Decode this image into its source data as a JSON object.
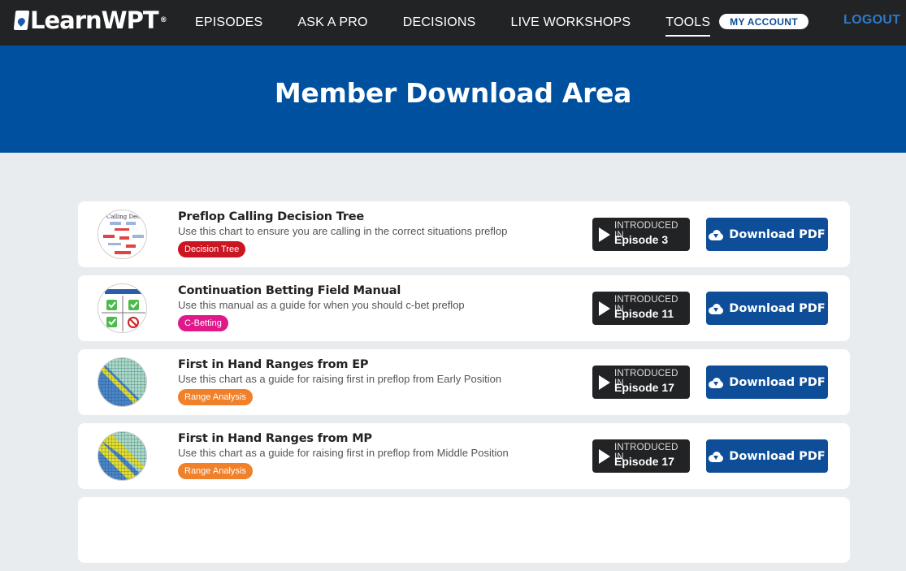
{
  "header": {
    "logo": "LearnWPT",
    "logo_mark": "®",
    "nav": [
      "EPISODES",
      "ASK A PRO",
      "DECISIONS",
      "LIVE WORKSHOPS",
      "TOOLS"
    ],
    "active_nav": "TOOLS",
    "account_label": "MY ACCOUNT",
    "logout_label": "LOGOUT"
  },
  "hero": {
    "title": "Member Download Area"
  },
  "items": [
    {
      "title": "Preflop Calling Decision Tree",
      "desc": "Use this chart to ensure you are calling in the correct situations preflop",
      "tag": "Decision Tree",
      "tag_color": "#cc1522",
      "intro": "INTRODUCED IN",
      "episode": "Episode 3",
      "button": "Download PDF",
      "thumb": "calling"
    },
    {
      "title": "Continuation Betting Field Manual",
      "desc": "Use this manual as a guide for when you should c-bet preflop",
      "tag": "C-Betting",
      "tag_color": "#e0198b",
      "intro": "INTRODUCED IN",
      "episode": "Episode 11",
      "button": "Download PDF",
      "thumb": "cbet"
    },
    {
      "title": "First in Hand Ranges from EP",
      "desc": "Use this chart as a guide for raising first in preflop from Early Position",
      "tag": "Range Analysis",
      "tag_color": "#f0802a",
      "intro": "INTRODUCED IN",
      "episode": "Episode 17",
      "button": "Download PDF",
      "thumb": "range-ep"
    },
    {
      "title": "First in Hand Ranges from MP",
      "desc": "Use this chart as a guide for raising first in preflop from Middle Position",
      "tag": "Range Analysis",
      "tag_color": "#f0802a",
      "intro": "INTRODUCED IN",
      "episode": "Episode 17",
      "button": "Download PDF",
      "thumb": "range-mp"
    }
  ],
  "icons": {
    "play": "play-icon",
    "download": "cloud-download-icon",
    "logo": "card-logo-icon"
  },
  "colors": {
    "topbar": "#222325",
    "hero": "#0050a0",
    "button": "#0e4d97",
    "logout": "#2e79c9",
    "background": "#e9ecee"
  }
}
